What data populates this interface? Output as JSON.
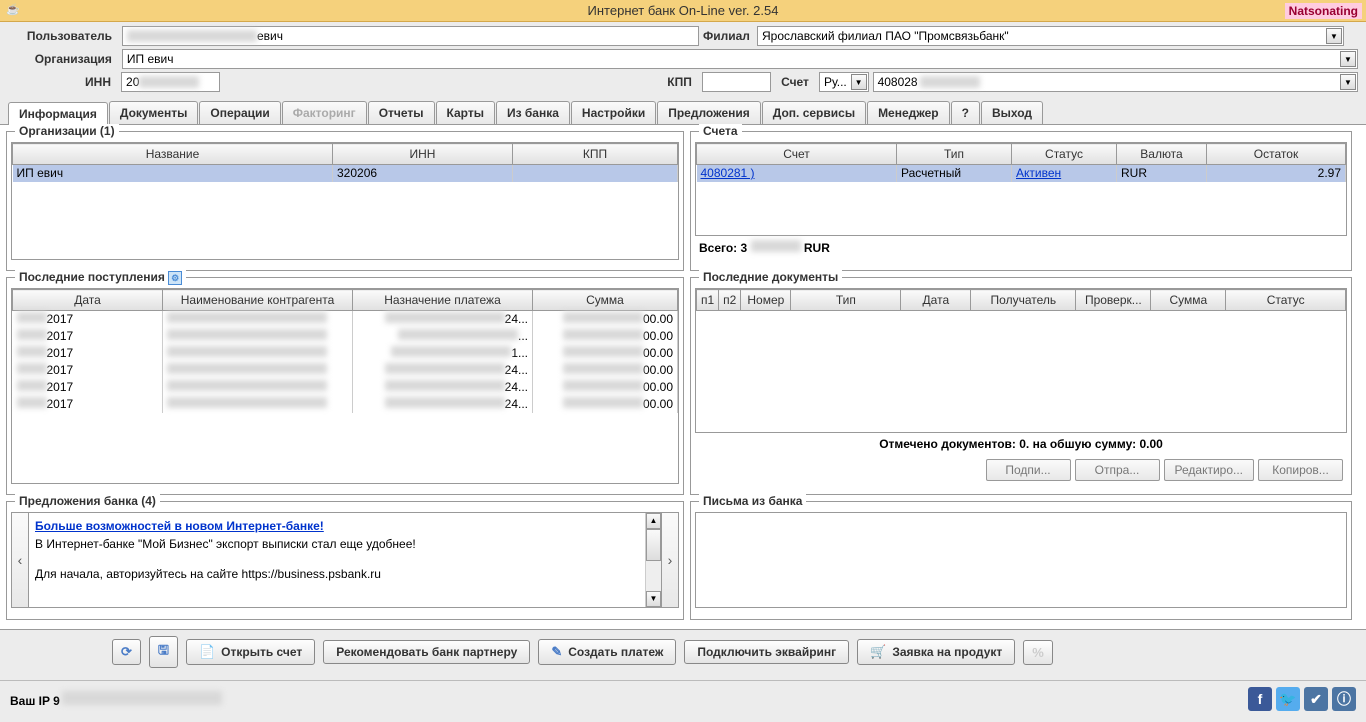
{
  "title": "Интернет банк On-Line ver. 2.54",
  "watermark": "Natsonating",
  "header": {
    "user_label": "Пользователь",
    "user_value": "евич",
    "branch_label": "Филиал",
    "branch_value": "Ярославский филиал ПАО \"Промсвязьбанк\"",
    "org_label": "Организация",
    "org_value": "ИП                                              евич",
    "inn_label": "ИНН",
    "inn_value": "20",
    "kpp_label": "КПП",
    "kpp_value": "",
    "acct_label": "Счет",
    "currency": "Ру...",
    "acct_value": "408028"
  },
  "tabs": [
    "Информация",
    "Документы",
    "Операции",
    "Факторинг",
    "Отчеты",
    "Карты",
    "Из банка",
    "Настройки",
    "Предложения",
    "Доп. сервисы",
    "Менеджер",
    "?",
    "Выход"
  ],
  "orgs": {
    "title": "Организации (1)",
    "cols": [
      "Название",
      "ИНН",
      "КПП"
    ],
    "row": {
      "name": "ИП                                    евич",
      "inn": "320206",
      "kpp": ""
    }
  },
  "accounts": {
    "title": "Счета",
    "cols": [
      "Счет",
      "Тип",
      "Статус",
      "Валюта",
      "Остаток"
    ],
    "row": {
      "num": "4080281                         )",
      "type": "Расчетный",
      "status": "Активен",
      "cur": "RUR",
      "bal": "2.97"
    },
    "total_label": "Всего: 3",
    "total_cur": "RUR"
  },
  "receipts": {
    "title": "Последние поступления",
    "cols": [
      "Дата",
      "Наименование контрагента",
      "Назначение платежа",
      "Сумма"
    ],
    "rows": [
      {
        "date": "2017",
        "name": "",
        "purpose": "24...",
        "sum": "00.00"
      },
      {
        "date": "2017",
        "name": "",
        "purpose": "...",
        "sum": "00.00"
      },
      {
        "date": "2017",
        "name": "",
        "purpose": "1...",
        "sum": "00.00"
      },
      {
        "date": "2017",
        "name": "",
        "purpose": "24...",
        "sum": "00.00"
      },
      {
        "date": "2017",
        "name": "",
        "purpose": "24...",
        "sum": "00.00"
      },
      {
        "date": "2017",
        "name": "",
        "purpose": "24...",
        "sum": "00.00"
      }
    ]
  },
  "docs": {
    "title": "Последние документы",
    "cols": [
      "п1",
      "п2",
      "Номер",
      "Тип",
      "Дата",
      "Получатель",
      "Проверк...",
      "Сумма",
      "Статус"
    ],
    "footer": "Отмечено документов: 0. на обшую сумму: 0.00",
    "buttons": [
      "Подпи...",
      "Отпра...",
      "Редактиро...",
      "Копиров..."
    ]
  },
  "offers": {
    "title": "Предложения банка (4)",
    "headline": "Больше возможностей в новом Интернет-банке!",
    "line1": "В Интернет-банке \"Мой Бизнес\" экспорт выписки стал еще удобнее!",
    "line2": "Для начала, авторизуйтесь на сайте https://business.psbank.ru"
  },
  "letters": {
    "title": "Письма из банка"
  },
  "toolbar": {
    "open": "Открыть счет",
    "recommend": "Рекомендовать банк партнеру",
    "create": "Создать платеж",
    "acquiring": "Подключить эквайринг",
    "product": "Заявка на продукт"
  },
  "status": {
    "ip": "Ваш IP 9"
  }
}
